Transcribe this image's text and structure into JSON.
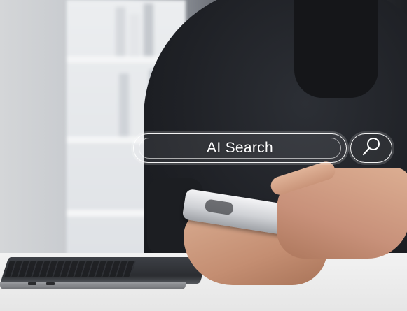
{
  "search": {
    "label": "AI Search",
    "icon": "search-icon"
  },
  "colors": {
    "overlay": "#ffffff",
    "jacket": "#1f2126",
    "desk": "#f0f0f0"
  }
}
